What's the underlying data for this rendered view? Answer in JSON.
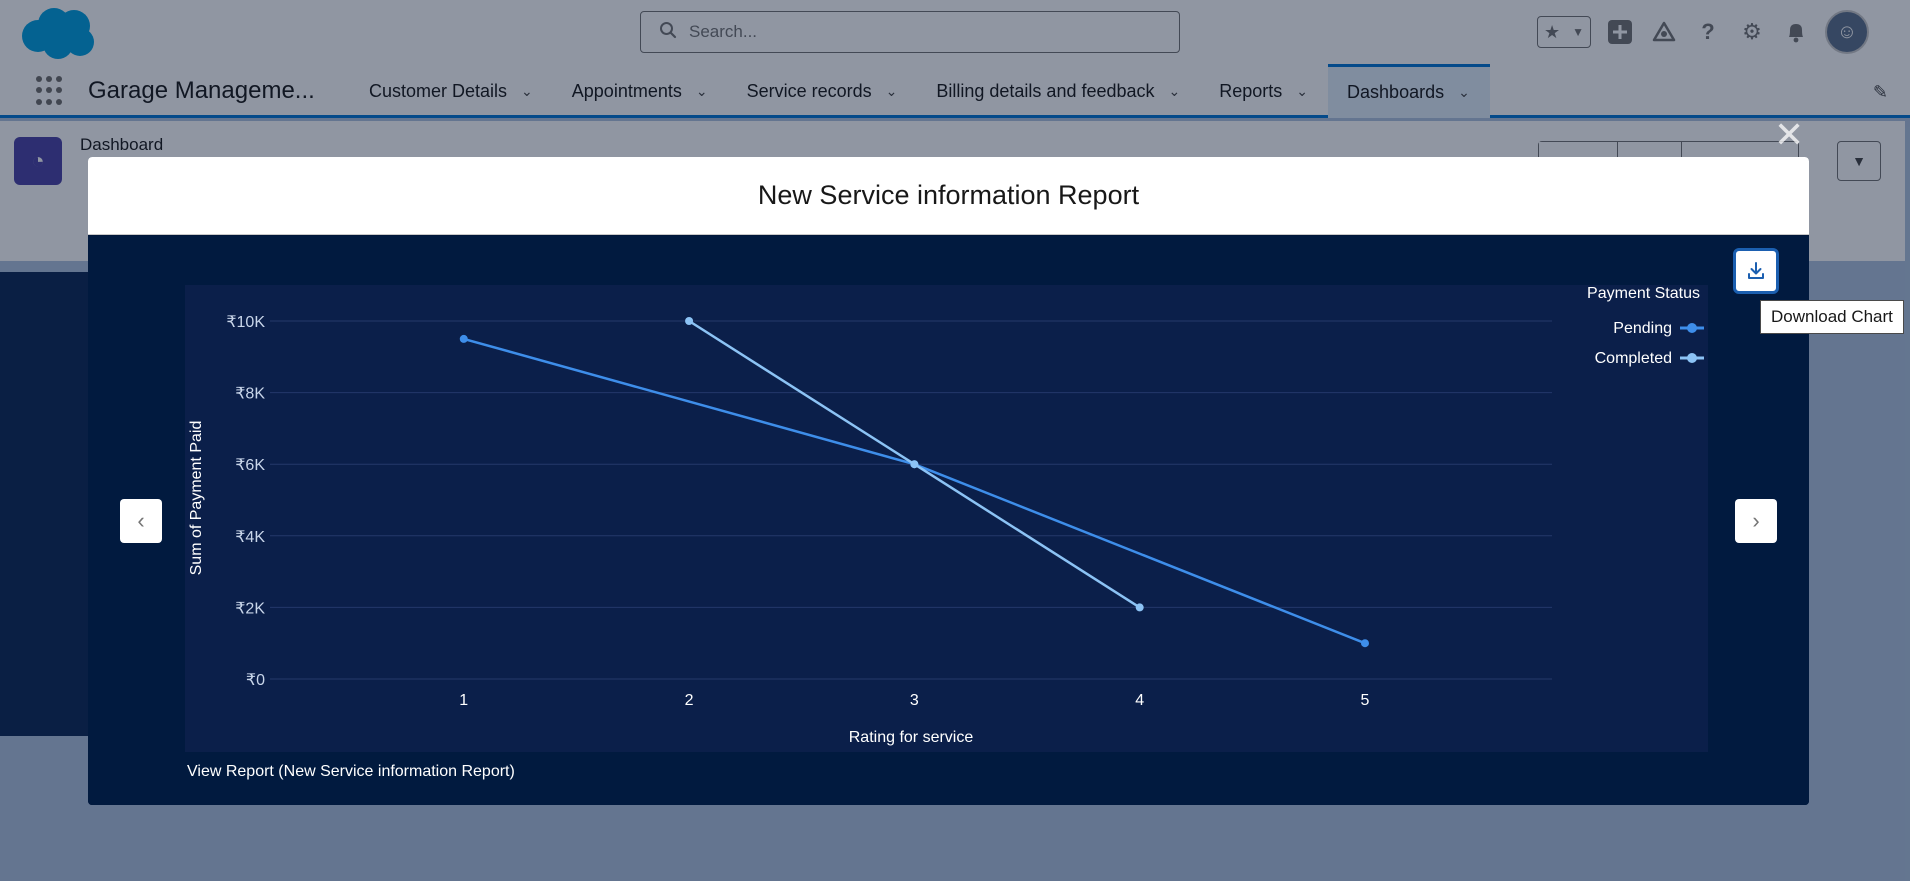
{
  "header": {
    "search_placeholder": "Search...",
    "icons": [
      "favorites-icon",
      "add-icon",
      "trailhead-icon",
      "help-icon",
      "setup-gear-icon",
      "notifications-bell-icon",
      "user-avatar"
    ]
  },
  "nav": {
    "app_name": "Garage Manageme...",
    "items": [
      {
        "label": "Customer Details"
      },
      {
        "label": "Appointments"
      },
      {
        "label": "Service records"
      },
      {
        "label": "Billing details and feedback"
      },
      {
        "label": "Reports"
      },
      {
        "label": "Dashboards",
        "active": true
      }
    ]
  },
  "dashboard": {
    "object_label": "Dashboard"
  },
  "modal": {
    "title": "New Service information Report",
    "view_report_link": "View Report (New Service information Report)",
    "download_tooltip": "Download Chart"
  },
  "colors": {
    "brand_blue": "#0176d3",
    "modal_bg": "#011a3f",
    "plot_bg": "#0b1f4a",
    "series_pending": "#3e8eea",
    "series_completed": "#8cc3f5"
  },
  "chart_data": {
    "type": "line",
    "xlabel": "Rating for service",
    "ylabel": "Sum of Payment Paid",
    "x": [
      1,
      2,
      3,
      4,
      5
    ],
    "x_tick_labels": [
      "1",
      "2",
      "3",
      "4",
      "5"
    ],
    "ylim": [
      0,
      10000
    ],
    "y_ticks": [
      0,
      2000,
      4000,
      6000,
      8000,
      10000
    ],
    "y_tick_labels": [
      "₹0",
      "₹2K",
      "₹4K",
      "₹6K",
      "₹8K",
      "₹10K"
    ],
    "legend_title": "Payment Status",
    "legend_position": "top-right",
    "grid": true,
    "series": [
      {
        "name": "Pending",
        "color": "#3e8eea",
        "points": [
          [
            1,
            9500
          ],
          [
            3,
            6000
          ],
          [
            5,
            1000
          ]
        ]
      },
      {
        "name": "Completed",
        "color": "#8cc3f5",
        "points": [
          [
            2,
            10000
          ],
          [
            3,
            6000
          ],
          [
            4,
            2000
          ]
        ]
      }
    ]
  }
}
